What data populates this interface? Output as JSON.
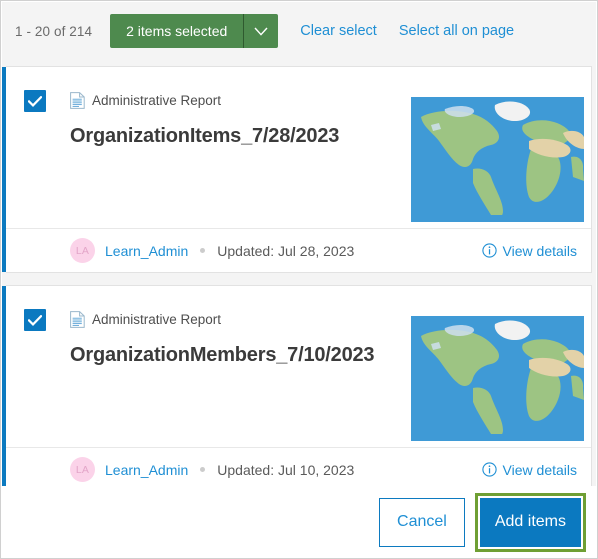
{
  "toolbar": {
    "count_text": "1 - 20 of 214",
    "selection_button_label": "2 items selected",
    "dropdown_icon": "chevron-down-icon",
    "clear_select_label": "Clear select",
    "select_all_label": "Select all on page",
    "green_accent": "#4e8a4e"
  },
  "results": [
    {
      "selected": true,
      "type_icon": "document-icon",
      "type_label": "Administrative Report",
      "title": "OrganizationItems_7/28/2023",
      "thumbnail": "world-map-thumbnail",
      "owner_initials": "LA",
      "owner": "Learn_Admin",
      "updated": "Updated: Jul 28, 2023",
      "details_icon": "info-circle-icon",
      "details_label": "View details"
    },
    {
      "selected": true,
      "type_icon": "document-icon",
      "type_label": "Administrative Report",
      "title": "OrganizationMembers_7/10/2023",
      "thumbnail": "world-map-thumbnail",
      "owner_initials": "LA",
      "owner": "Learn_Admin",
      "updated": "Updated: Jul 10, 2023",
      "details_icon": "info-circle-icon",
      "details_label": "View details"
    }
  ],
  "actions": {
    "cancel_label": "Cancel",
    "add_items_label": "Add items",
    "add_items_highlight_color": "#6f9f34",
    "primary_color": "#0b79c0"
  }
}
